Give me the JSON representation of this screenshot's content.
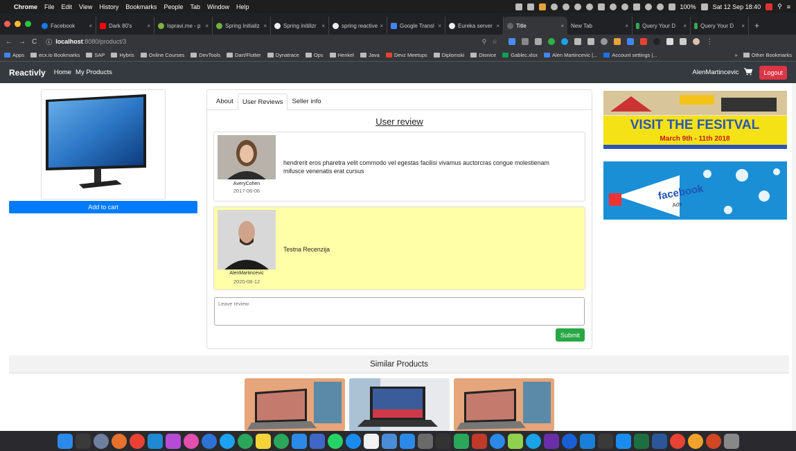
{
  "menubar": {
    "app": "Chrome",
    "items": [
      "File",
      "Edit",
      "View",
      "History",
      "Bookmarks",
      "People",
      "Tab",
      "Window",
      "Help"
    ],
    "battery": "100%",
    "clock": "Sat 12 Sep  18:40"
  },
  "tabs": [
    {
      "label": "Facebook",
      "color": "#1877f2"
    },
    {
      "label": "Dark 80's",
      "color": "#ff0000"
    },
    {
      "label": "Ispravi.me - p",
      "color": "#7cb342"
    },
    {
      "label": "Spring Initializ",
      "color": "#6db33f"
    },
    {
      "label": "Spring initilizr",
      "color": "#6db33f"
    },
    {
      "label": "spring reactive",
      "color": "#6db33f"
    },
    {
      "label": "Google Transl",
      "color": "#4285f4"
    },
    {
      "label": "Eureka server",
      "color": "#4285f4"
    },
    {
      "label": "Title",
      "color": "#666666",
      "active": true
    },
    {
      "label": "New Tab",
      "color": "#35363a"
    },
    {
      "label": "Query Your D",
      "color": "#34a853"
    },
    {
      "label": "Query Your D",
      "color": "#34a853"
    }
  ],
  "address": {
    "host": "localhost",
    "path": ":8080/product/3"
  },
  "bookmarks": {
    "items": [
      "Apps",
      "ecx.io Bookmarks",
      "SAP",
      "Hybris",
      "Online Courses",
      "DevTools",
      "Dart/Flutter",
      "Dynatrace",
      "Ops",
      "Henkel",
      "Java",
      "Devz Meetups",
      "Diplomski",
      "Dionice",
      "Gablec.xlsx",
      "Alen Martincevic |...",
      "Account settings |..."
    ],
    "other": "Other Bookmarks"
  },
  "appnav": {
    "brand": "Reactivly",
    "links": [
      "Home",
      "My Products"
    ],
    "username": "AlenMartincevic",
    "logout": "Logout"
  },
  "product": {
    "add_to_cart": "Add to cart"
  },
  "product_tabs": [
    "About",
    "User Reviews",
    "Seller info"
  ],
  "reviews": {
    "title": "User review",
    "items": [
      {
        "author": "AveryCohen",
        "date": "2017-06-06",
        "text": "hendrerit eros pharetra velit commodo vel egestas facilisi vivamus auctorcras congue molestienam mifusce venenatis erat cursus"
      },
      {
        "author": "AlenMartincevic",
        "date": "2020-08-12",
        "text": "Testna Recenzija"
      }
    ],
    "input_placeholder": "Leave review",
    "submit": "Submit"
  },
  "ads": {
    "festival": {
      "line1": "VISIT THE FESITVAL",
      "line2": "March 9th - 11th 2018"
    },
    "facebook": {
      "line1": "facebook",
      "line2": "Ads"
    }
  },
  "similar": {
    "title": "Similar Products"
  }
}
